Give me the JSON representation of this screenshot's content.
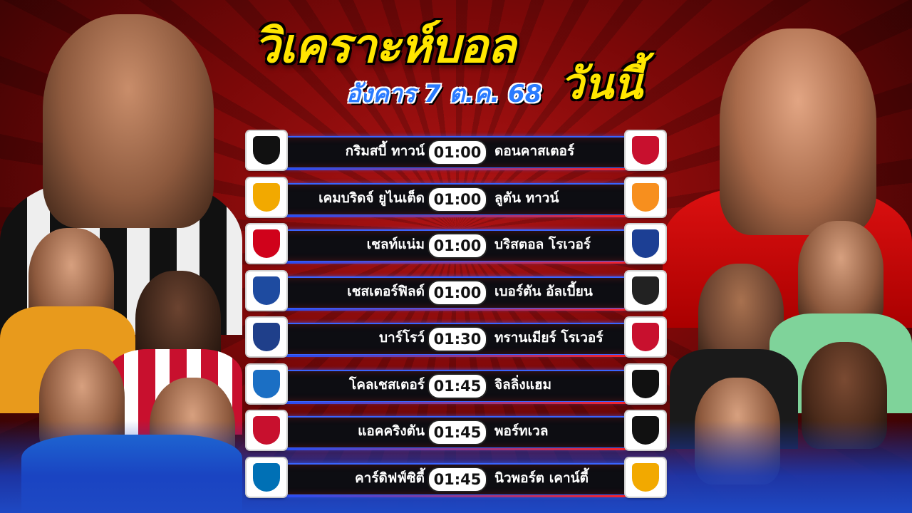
{
  "header": {
    "title_line1": "วิเคราะห์บอล",
    "title_line2": "วันนี้",
    "date": "อังคาร 7 ต.ค. 68"
  },
  "colors": {
    "title": "#ffe600",
    "date": "#2a7bff",
    "background": "#8e0a0a",
    "bar_border": "#3a64ff"
  },
  "matches": [
    {
      "home": "กริมสบี้ ทาวน์",
      "time": "01:00",
      "away": "ดอนคาสเตอร์",
      "home_logo": "grimsby-crest",
      "away_logo": "doncaster-crest",
      "home_color": "#111111",
      "away_color": "#c8102e"
    },
    {
      "home": "เคมบริดจ์ ยูไนเต็ด",
      "time": "01:00",
      "away": "ลูตัน ทาวน์",
      "home_logo": "cambridge-crest",
      "away_logo": "luton-crest",
      "home_color": "#f2a900",
      "away_color": "#f78f1e"
    },
    {
      "home": "เชลท์แน่ม",
      "time": "01:00",
      "away": "บริสตอล โรเวอร์",
      "home_logo": "cheltenham-crest",
      "away_logo": "bristol-rovers-crest",
      "home_color": "#d0021b",
      "away_color": "#1c3f94"
    },
    {
      "home": "เชสเตอร์ฟิลด์",
      "time": "01:00",
      "away": "เบอร์ตัน อัลเบี้ยน",
      "home_logo": "chesterfield-crest",
      "away_logo": "burton-crest",
      "home_color": "#1e4ba0",
      "away_color": "#222222"
    },
    {
      "home": "บาร์โรว์",
      "time": "01:30",
      "away": "ทรานเมียร์ โรเวอร์",
      "home_logo": "barrow-crest",
      "away_logo": "tranmere-crest",
      "home_color": "#1f3f8a",
      "away_color": "#c8102e"
    },
    {
      "home": "โคลเชสเตอร์",
      "time": "01:45",
      "away": "จิลลิ่งแฮม",
      "home_logo": "colchester-crest",
      "away_logo": "gillingham-crest",
      "home_color": "#1b6fc4",
      "away_color": "#111111"
    },
    {
      "home": "แอคคริงตัน",
      "time": "01:45",
      "away": "พอร์ทเวล",
      "home_logo": "accrington-crest",
      "away_logo": "port-vale-crest",
      "home_color": "#c8102e",
      "away_color": "#111111"
    },
    {
      "home": "คาร์ดิฟฟ์ซิตี้",
      "time": "01:45",
      "away": "นิวพอร์ต เคาน์ตี้",
      "home_logo": "cardiff-crest",
      "away_logo": "newport-crest",
      "home_color": "#0070b5",
      "away_color": "#f2a900"
    }
  ]
}
